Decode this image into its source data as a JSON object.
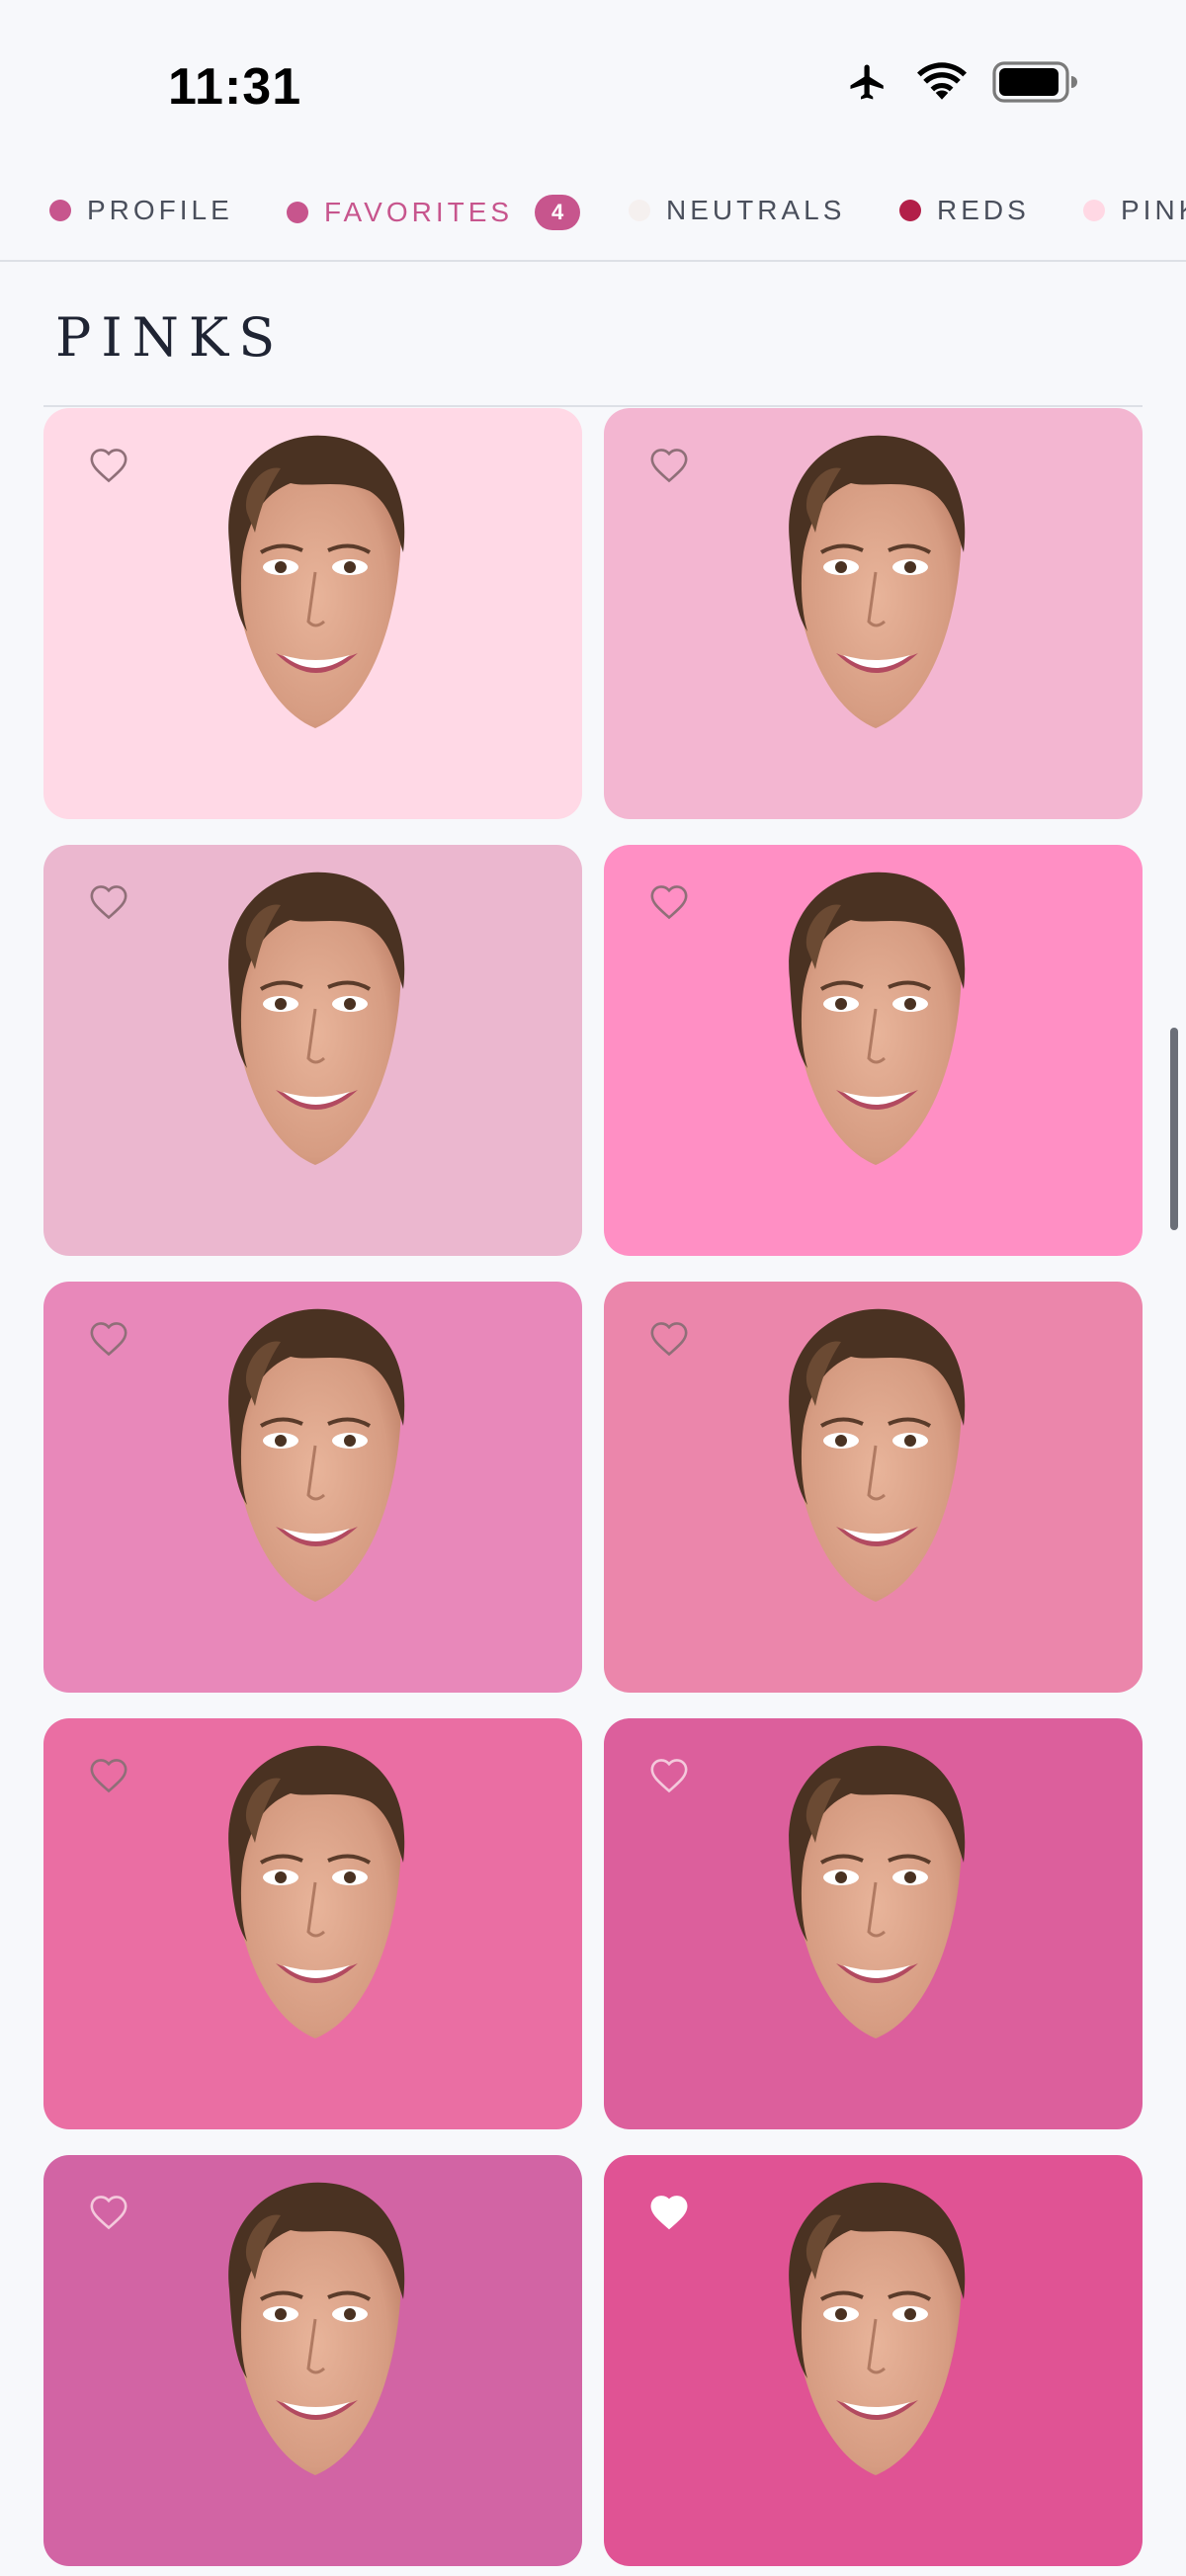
{
  "status": {
    "time": "11:31",
    "icons": [
      "airplane-icon",
      "wifi-icon",
      "battery-icon"
    ]
  },
  "tabs": [
    {
      "label": "PROFILE",
      "dot_color": "#c7558d",
      "active": false
    },
    {
      "label": "FAVORITES",
      "dot_color": "#c7558d",
      "active": true,
      "badge": "4"
    },
    {
      "label": "NEUTRALS",
      "dot_color": "#f5f0ef",
      "active": false
    },
    {
      "label": "REDS",
      "dot_color": "#b21f48",
      "active": false
    },
    {
      "label": "PINKS",
      "dot_color": "#ffd8e4",
      "active": false
    }
  ],
  "section": {
    "title": "PINKS"
  },
  "swatches": [
    {
      "color": "#ffd9e6",
      "favorite": false,
      "heart_color": "#8f6f78"
    },
    {
      "color": "#f3b6d1",
      "favorite": false,
      "heart_color": "#8f6f78"
    },
    {
      "color": "#ebb7cf",
      "favorite": false,
      "heart_color": "#8f6f78"
    },
    {
      "color": "#ff8fc4",
      "favorite": false,
      "heart_color": "#8f6f78"
    },
    {
      "color": "#e888ba",
      "favorite": false,
      "heart_color": "#8f6f78"
    },
    {
      "color": "#eb86ab",
      "favorite": false,
      "heart_color": "#8f6f78"
    },
    {
      "color": "#ea6ea3",
      "favorite": false,
      "heart_color": "#8f6f78"
    },
    {
      "color": "#dc5f9c",
      "favorite": false,
      "heart_color": "#f4c9dc"
    },
    {
      "color": "#d264a4",
      "favorite": false,
      "heart_color": "#f4c9dc"
    },
    {
      "color": "#e05394",
      "favorite": true,
      "heart_color": "#ffffff"
    }
  ]
}
